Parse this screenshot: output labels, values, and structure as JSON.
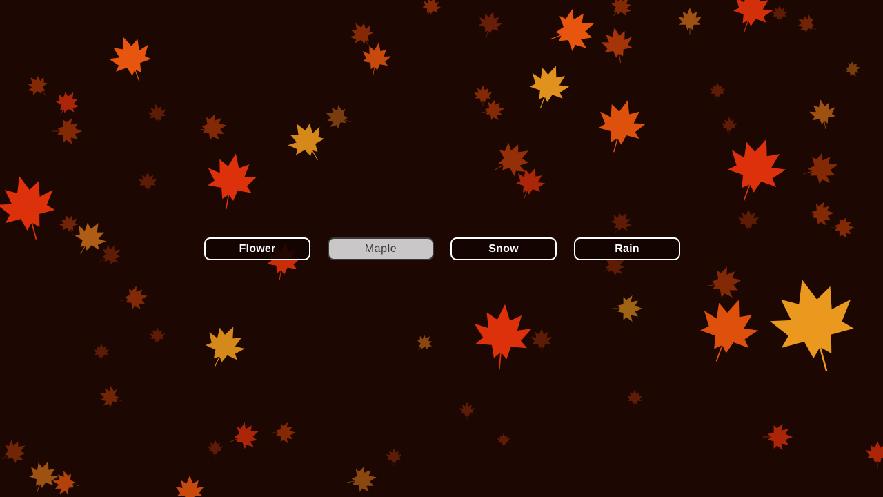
{
  "scene": {
    "background_color": "#1c0702",
    "selected_effect": "Maple"
  },
  "effect_buttons": [
    {
      "label": "Flower",
      "selected": false
    },
    {
      "label": "Maple",
      "selected": true
    },
    {
      "label": "Snow",
      "selected": false
    },
    {
      "label": "Rain",
      "selected": false
    }
  ],
  "leaf_palette": [
    "#e8340c",
    "#f25a0f",
    "#f7a020",
    "#c8410a",
    "#8a2a0a",
    "#d4721a"
  ]
}
